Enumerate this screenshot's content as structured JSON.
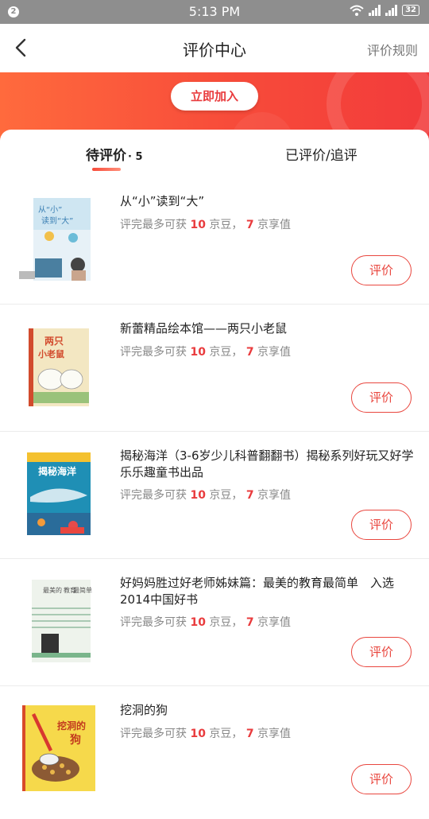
{
  "status": {
    "badge": "2",
    "time": "5:13 PM",
    "battery": "32"
  },
  "nav": {
    "title": "评价中心",
    "right_label": "评价规则"
  },
  "banner": {
    "join_label": "立即加入"
  },
  "tabs": {
    "pending_label": "待评价",
    "pending_count": "· 5",
    "done_label": "已评价/追评"
  },
  "reward": {
    "prefix": "评完最多可获",
    "beans": "10",
    "beans_unit": "京豆，",
    "value": "7",
    "value_unit": "京享值"
  },
  "items": [
    {
      "title": "从“小”读到“大”",
      "button": "评价"
    },
    {
      "title": "新蕾精品绘本馆——两只小老鼠",
      "button": "评价"
    },
    {
      "title": "揭秘海洋（3-6岁少儿科普翻翻书）揭秘系列好玩又好学 乐乐趣童书出品",
      "button": "评价"
    },
    {
      "title": "好妈妈胜过好老师姊妹篇：最美的教育最简单　入选2014中国好书",
      "button": "评价"
    },
    {
      "title": "挖洞的狗",
      "button": "评价"
    }
  ],
  "covers": [
    {
      "lines": [
        "从“小”",
        "读到“大”"
      ]
    },
    {
      "lines": [
        "两只",
        "小老鼠"
      ]
    },
    {
      "lines": [
        "揭秘海洋"
      ]
    },
    {
      "lines": [
        "最美的",
        "教育",
        "最简单"
      ]
    },
    {
      "lines": [
        "挖洞的",
        "狗"
      ]
    }
  ],
  "colors": {
    "accent": "#e93b3d",
    "banner_start": "#ff6a3d",
    "banner_end": "#f23b3b",
    "statusbar": "#8e8e8e"
  }
}
